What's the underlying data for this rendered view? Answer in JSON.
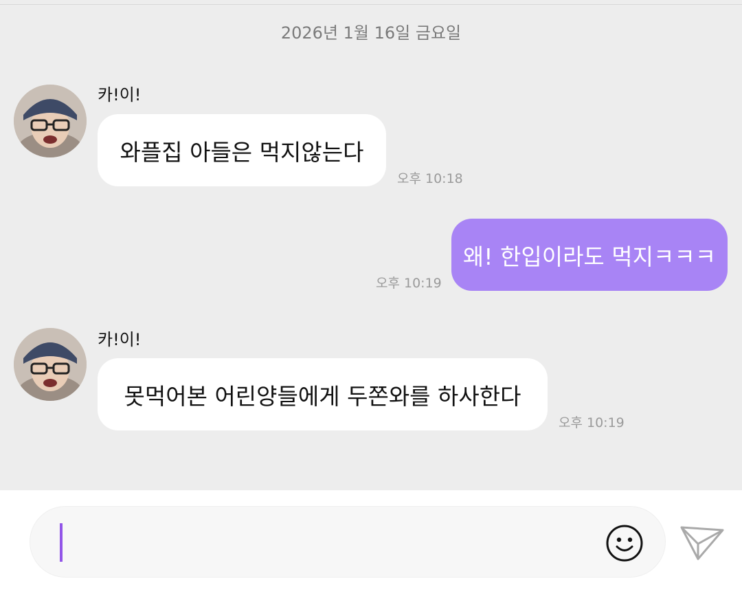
{
  "chat": {
    "date": "2026년 1월 16일 금요일",
    "messages": [
      {
        "sender": "카!이!",
        "text": "와플집 아들은 먹지않는다",
        "time": "오후 10:18",
        "direction": "incoming"
      },
      {
        "text": "왜! 한입이라도 먹지ㅋㅋㅋ",
        "time": "오후 10:19",
        "direction": "outgoing"
      },
      {
        "sender": "카!이!",
        "text": "못먹어본 어린양들에게 두쫀와를 하사한다",
        "time": "오후 10:19",
        "direction": "incoming"
      }
    ]
  },
  "composer": {
    "value": "",
    "emoji_icon": "smiley-icon",
    "send_icon": "paper-plane-icon"
  },
  "colors": {
    "background": "#ededed",
    "incoming_bubble": "#ffffff",
    "outgoing_bubble": "#a884f5",
    "caret": "#9255e8"
  }
}
